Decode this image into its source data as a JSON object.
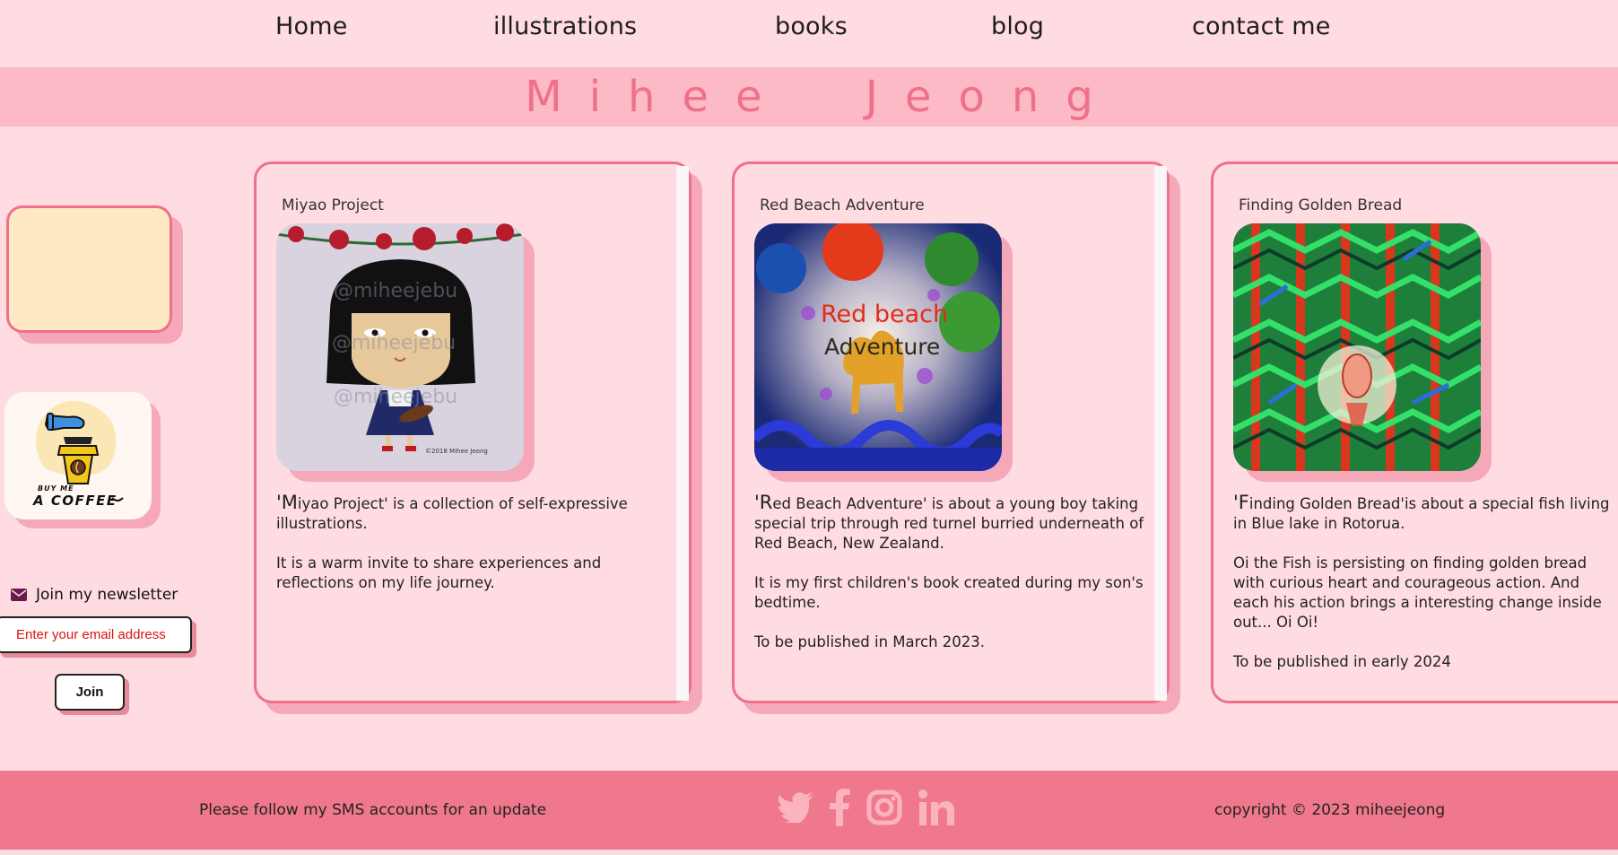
{
  "nav": {
    "items": [
      {
        "label": "Home"
      },
      {
        "label": "illustrations"
      },
      {
        "label": "books"
      },
      {
        "label": "blog"
      },
      {
        "label": "contact me"
      }
    ]
  },
  "banner": {
    "title": "Mihee Jeong"
  },
  "sidebar": {
    "coffee": {
      "small": "BUY ME",
      "big": "A COFFEE"
    },
    "newsletter": {
      "label": "Join my newsletter",
      "email_placeholder": "Enter your email address",
      "join_label": "Join"
    }
  },
  "cards": [
    {
      "title": "Miyao Project",
      "image_text": "@miheejebu",
      "image_signature": "©2018 Mihee Jeong",
      "paragraphs": [
        "'Miyao Project' is a collection of self-expressive illustrations.",
        "It is a warm invite to share experiences and reflections on my life journey."
      ]
    },
    {
      "title": "Red Beach Adventure",
      "image_text_1": "Red beach",
      "image_text_2": "Adventure",
      "paragraphs": [
        "'Red Beach Adventure' is about a young boy taking special trip through red turnel burried underneath of Red Beach, New Zealand.",
        "It is my first children's book created during my son's bedtime.",
        "To be published in March 2023."
      ]
    },
    {
      "title": "Finding Golden Bread",
      "paragraphs": [
        "'Finding Golden Bread'is about a special fish living in Blue lake in Rotorua.",
        "Oi the Fish is persisting on finding golden bread with curious heart and courageous action. And each his action brings a interesting change inside out... Oi Oi!",
        "To be published in early 2024"
      ]
    }
  ],
  "footer": {
    "follow": "Please follow my SMS accounts for an update",
    "copyright": "copyright © 2023 miheejeong",
    "icons": [
      "twitter-icon",
      "facebook-icon",
      "instagram-icon",
      "linkedin-icon"
    ]
  },
  "colors": {
    "background": "#ffdbe2",
    "banner": "#fcb9c6",
    "accent": "#f0708a",
    "footer": "#f0788d",
    "footer_icons": "#fbb3c0"
  }
}
